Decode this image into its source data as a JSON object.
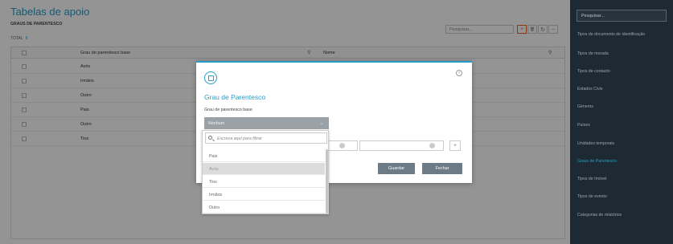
{
  "page": {
    "title": "Tabelas de apoio",
    "subtitle": "GRAUS DE PARENTESCO",
    "total_label": "TOTAL",
    "total_count": "6"
  },
  "toolbar": {
    "search_placeholder": "Pesquisar...",
    "add_symbol": "+",
    "delete_symbol": "🗑",
    "refresh_symbol": "↻",
    "more_symbol": "—"
  },
  "grid": {
    "columns": [
      "Grau de parentesco base",
      "Nome"
    ],
    "rows": [
      {
        "grau": "Avós"
      },
      {
        "grau": "Irmãos"
      },
      {
        "grau": "Outro"
      },
      {
        "grau": "Pais"
      },
      {
        "grau": "Outro"
      },
      {
        "grau": "Tios"
      }
    ]
  },
  "sidebar": {
    "search_placeholder": "Pesquisar...",
    "items": [
      {
        "label": "Tipos de documento de identificação"
      },
      {
        "label": "Tipos de morada"
      },
      {
        "label": "Tipos de contacto"
      },
      {
        "label": "Estados Civis"
      },
      {
        "label": "Géneros"
      },
      {
        "label": "Países"
      },
      {
        "label": "Unidades temporais"
      },
      {
        "label": "Graus de Parentesco",
        "active": true
      },
      {
        "label": "Tipos de Imóvel"
      },
      {
        "label": "Tipos de evento"
      },
      {
        "label": "Categorias de relatórios"
      }
    ]
  },
  "modal": {
    "title": "Grau de Parentesco",
    "close_symbol": "×",
    "field_label": "Grau de parentesco base",
    "select_value": "Nenhum",
    "select_caret": "⌄",
    "info_symbol": "i",
    "plus_symbol": "+",
    "save_label": "Guardar",
    "cancel_label": "Fechar"
  },
  "dropdown": {
    "filter_placeholder": "Escreva aqui para filtrar",
    "options": [
      {
        "label": "Pais"
      },
      {
        "label": "Avós",
        "hover": true
      },
      {
        "label": "Tios"
      },
      {
        "label": "Irmãos"
      },
      {
        "label": "Outro"
      }
    ]
  },
  "colors": {
    "accent": "#2a9bc8",
    "highlight_add": "#e8641f",
    "sidebar_bg": "#1e2a33",
    "button_bg": "#6c7b85"
  }
}
